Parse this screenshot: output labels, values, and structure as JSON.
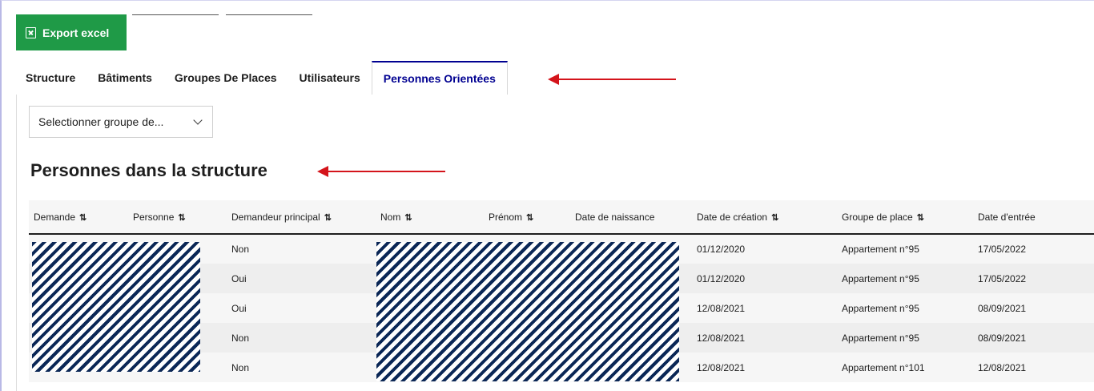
{
  "toolbar": {
    "export_label": "Export excel"
  },
  "tabs": [
    {
      "label": "Structure"
    },
    {
      "label": "Bâtiments"
    },
    {
      "label": "Groupes De Places"
    },
    {
      "label": "Utilisateurs"
    },
    {
      "label": "Personnes Orientées",
      "active": true
    }
  ],
  "filter": {
    "selected": "Selectionner groupe de..."
  },
  "section": {
    "title": "Personnes dans la structure"
  },
  "table": {
    "sort_icon": "⇅",
    "columns": [
      {
        "label": "Demande",
        "sortable": true
      },
      {
        "label": "Personne",
        "sortable": true
      },
      {
        "label": "Demandeur principal",
        "sortable": true
      },
      {
        "label": "Nom",
        "sortable": true
      },
      {
        "label": "Prénom",
        "sortable": true
      },
      {
        "label": "Date de naissance",
        "sortable": false
      },
      {
        "label": "Date de création",
        "sortable": true
      },
      {
        "label": "Groupe de place",
        "sortable": true
      },
      {
        "label": "Date d'entrée",
        "sortable": false
      }
    ],
    "rows": [
      {
        "demandeur_principal": "Non",
        "date_creation": "01/12/2020",
        "groupe_place": "Appartement n°95",
        "date_entree": "17/05/2022"
      },
      {
        "demandeur_principal": "Oui",
        "date_creation": "01/12/2020",
        "groupe_place": "Appartement n°95",
        "date_entree": "17/05/2022"
      },
      {
        "demandeur_principal": "Oui",
        "date_creation": "12/08/2021",
        "groupe_place": "Appartement n°95",
        "date_entree": "08/09/2021"
      },
      {
        "demandeur_principal": "Non",
        "date_creation": "12/08/2021",
        "groupe_place": "Appartement n°95",
        "date_entree": "08/09/2021"
      },
      {
        "demandeur_principal": "Non",
        "date_creation": "12/08/2021",
        "groupe_place": "Appartement n°101",
        "date_entree": "12/08/2021"
      }
    ]
  },
  "colors": {
    "export": "#1f9a47",
    "active_tab": "#000091",
    "annotation_arrow": "#d4141b",
    "redaction": "#0b2756"
  }
}
